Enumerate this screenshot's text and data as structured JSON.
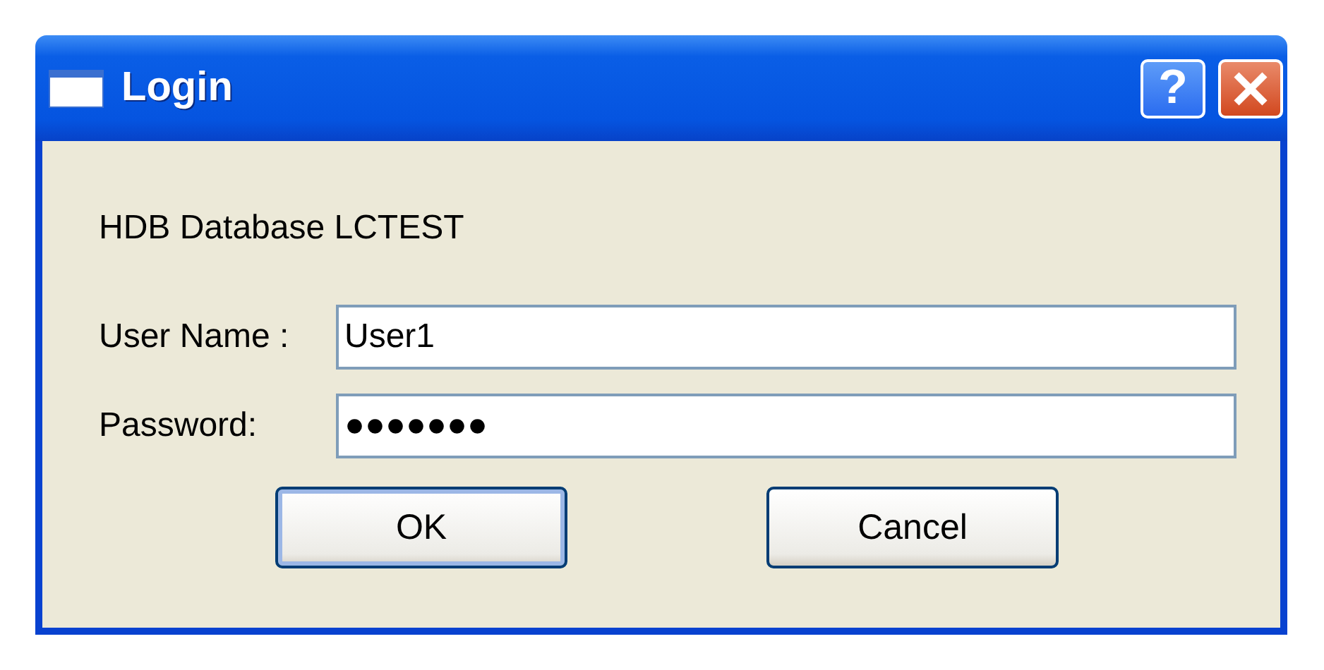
{
  "window": {
    "title": "Login",
    "help_button": "?"
  },
  "heading": "HDB Database LCTEST",
  "fields": [
    {
      "label": "User Name :",
      "value": "User1"
    },
    {
      "label": "Password:",
      "value": "●●●●●●●"
    }
  ],
  "buttons": [
    {
      "label": "OK",
      "default": true
    },
    {
      "label": "Cancel",
      "default": false
    }
  ]
}
